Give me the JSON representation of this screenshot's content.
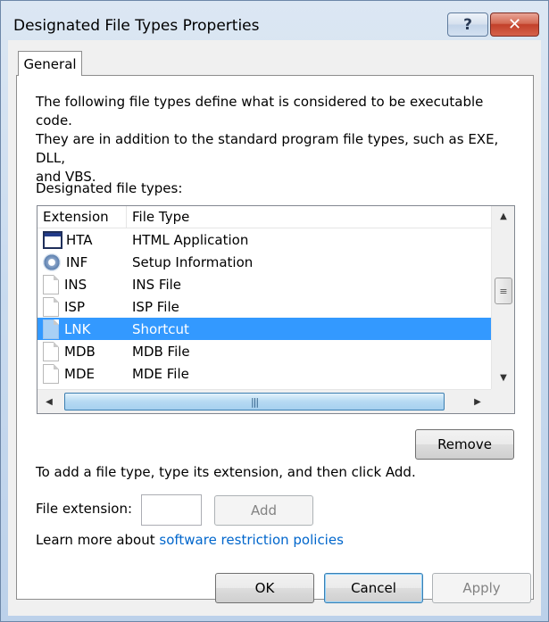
{
  "window": {
    "title": "Designated File Types Properties",
    "help_glyph": "?",
    "close_glyph": "✕"
  },
  "tabs": [
    {
      "label": "General",
      "selected": true
    }
  ],
  "description": {
    "line1": "The following file types define what is considered to be executable code.",
    "line2": "They are in addition to the standard program file types, such as EXE, DLL,",
    "line3": "and VBS."
  },
  "file_types_label": "Designated file types:",
  "list": {
    "columns": [
      "Extension",
      "File Type"
    ],
    "rows": [
      {
        "extension": "HTA",
        "file_type": "HTML Application",
        "icon": "hta-window-icon",
        "selected": false
      },
      {
        "extension": "INF",
        "file_type": "Setup Information",
        "icon": "setup-gear-icon",
        "selected": false
      },
      {
        "extension": "INS",
        "file_type": "INS File",
        "icon": "document-icon",
        "selected": false
      },
      {
        "extension": "ISP",
        "file_type": "ISP File",
        "icon": "document-icon",
        "selected": false
      },
      {
        "extension": "LNK",
        "file_type": "Shortcut",
        "icon": "shortcut-icon",
        "selected": true
      },
      {
        "extension": "MDB",
        "file_type": "MDB File",
        "icon": "document-icon",
        "selected": false
      },
      {
        "extension": "MDE",
        "file_type": "MDE File",
        "icon": "document-icon",
        "selected": false
      }
    ],
    "vscroll_up": "▲",
    "vscroll_down": "▼",
    "vscroll_grip": "≡",
    "hscroll_left": "◀",
    "hscroll_right": "▶",
    "hscroll_grip": "|||"
  },
  "remove_label": "Remove",
  "add_help": "To add a file type, type its extension, and then click Add.",
  "file_extension_label": "File extension:",
  "file_extension_value": "",
  "add_label": "Add",
  "learn_more_prefix": "Learn more about ",
  "learn_more_link": "software restriction policies",
  "footer": {
    "ok": "OK",
    "cancel": "Cancel",
    "apply": "Apply"
  },
  "colors": {
    "selection": "#3399ff",
    "link": "#0066cc"
  }
}
